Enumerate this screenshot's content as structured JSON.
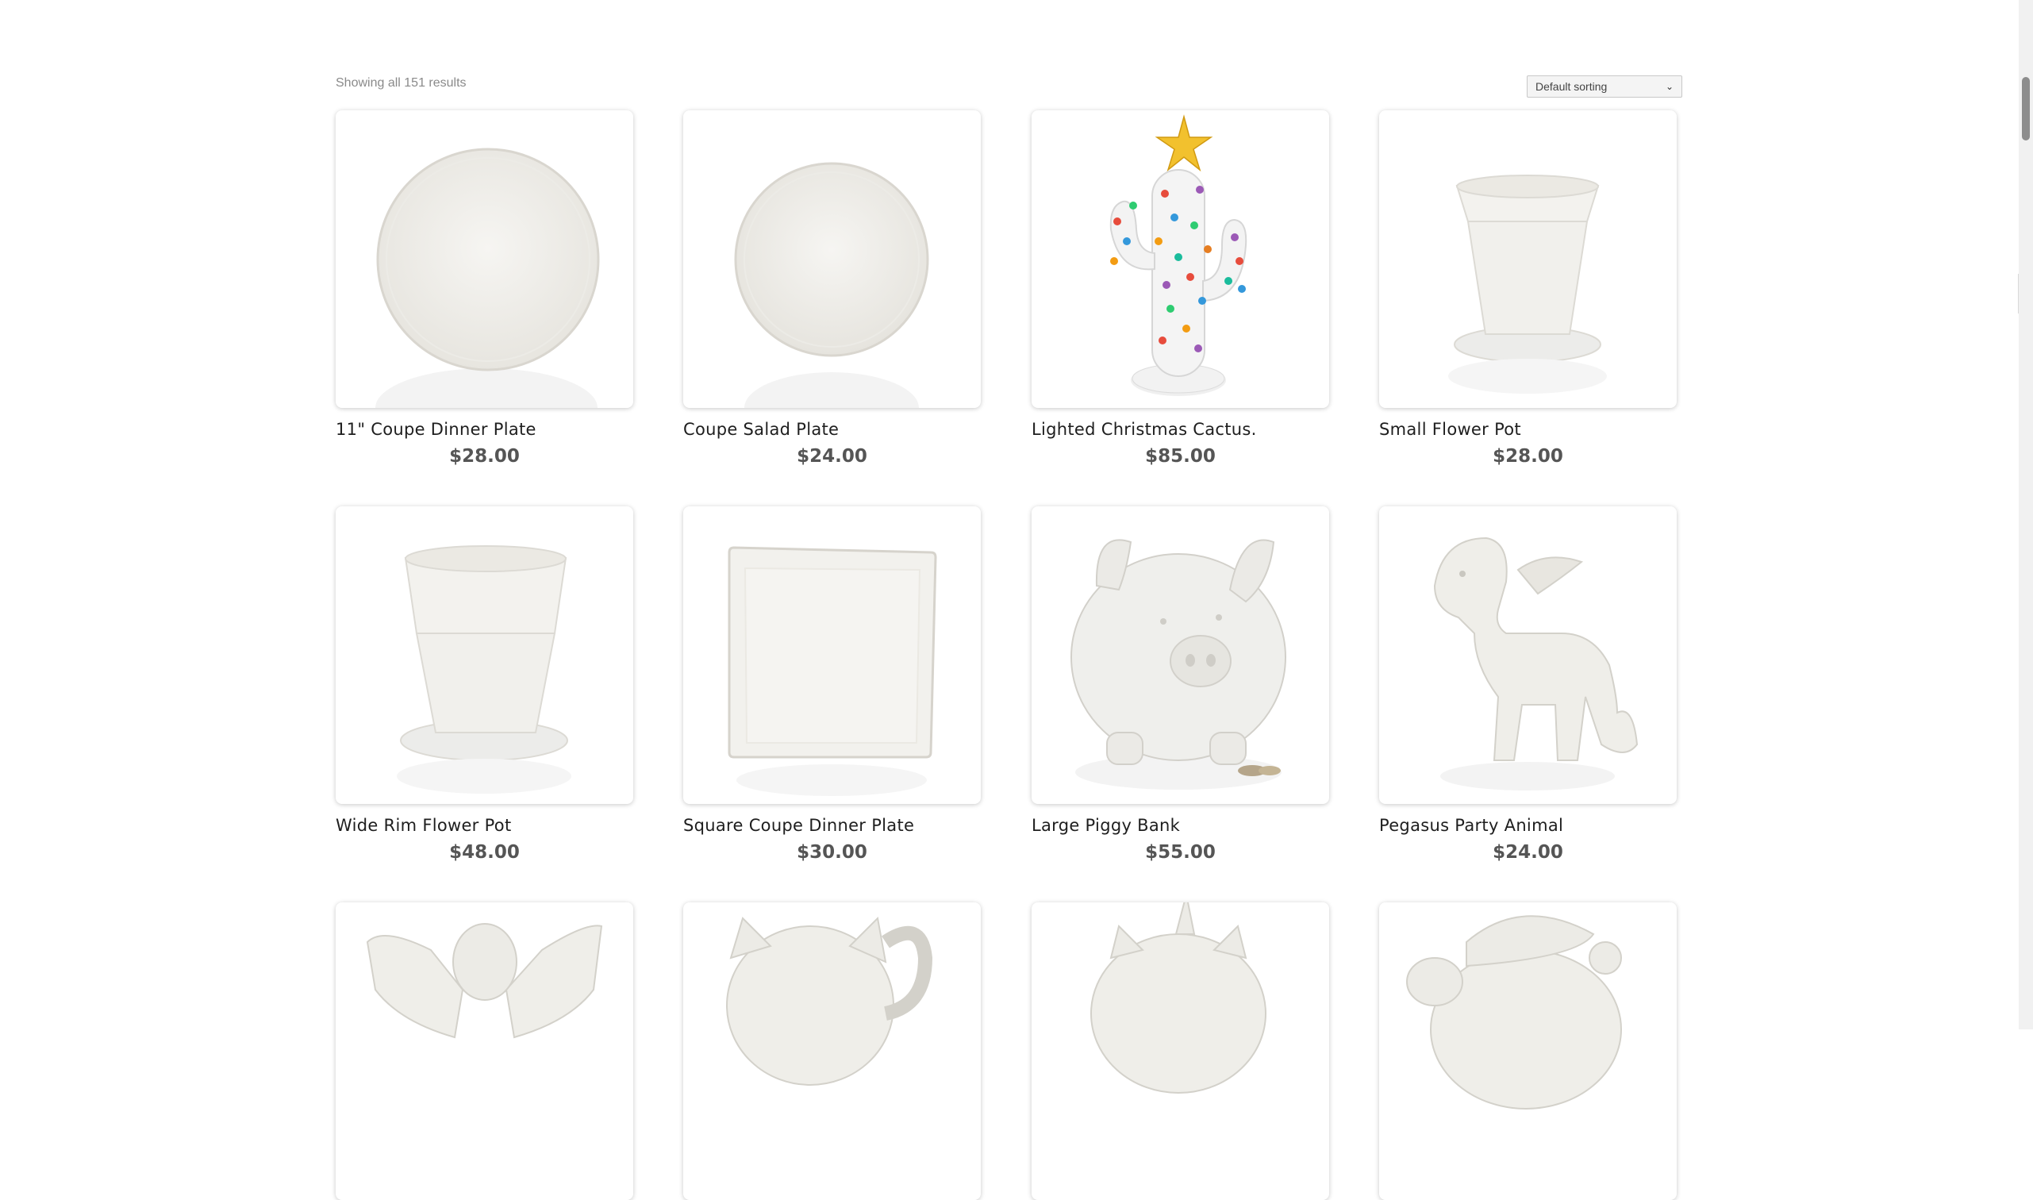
{
  "shop": {
    "results_count": "Showing all 151 results",
    "sort_selected": "Default sorting"
  },
  "products": [
    {
      "name": "11\" Coupe Dinner Plate",
      "price": "$28.00",
      "image": "round-plate"
    },
    {
      "name": "Coupe Salad Plate",
      "price": "$24.00",
      "image": "round-salad-plate"
    },
    {
      "name": "Lighted Christmas Cactus.",
      "price": "$85.00",
      "image": "cactus-with-lights"
    },
    {
      "name": "Small Flower Pot",
      "price": "$28.00",
      "image": "flower-pot-small"
    },
    {
      "name": "Wide Rim Flower Pot",
      "price": "$48.00",
      "image": "flower-pot-wide"
    },
    {
      "name": "Square Coupe Dinner Plate",
      "price": "$30.00",
      "image": "square-plate"
    },
    {
      "name": "Large Piggy Bank",
      "price": "$55.00",
      "image": "piggy-bank"
    },
    {
      "name": "Pegasus Party Animal",
      "price": "$24.00",
      "image": "pegasus"
    },
    {
      "image": "fairy"
    },
    {
      "image": "cat-mug"
    },
    {
      "image": "unicorn"
    },
    {
      "image": "santa"
    }
  ]
}
